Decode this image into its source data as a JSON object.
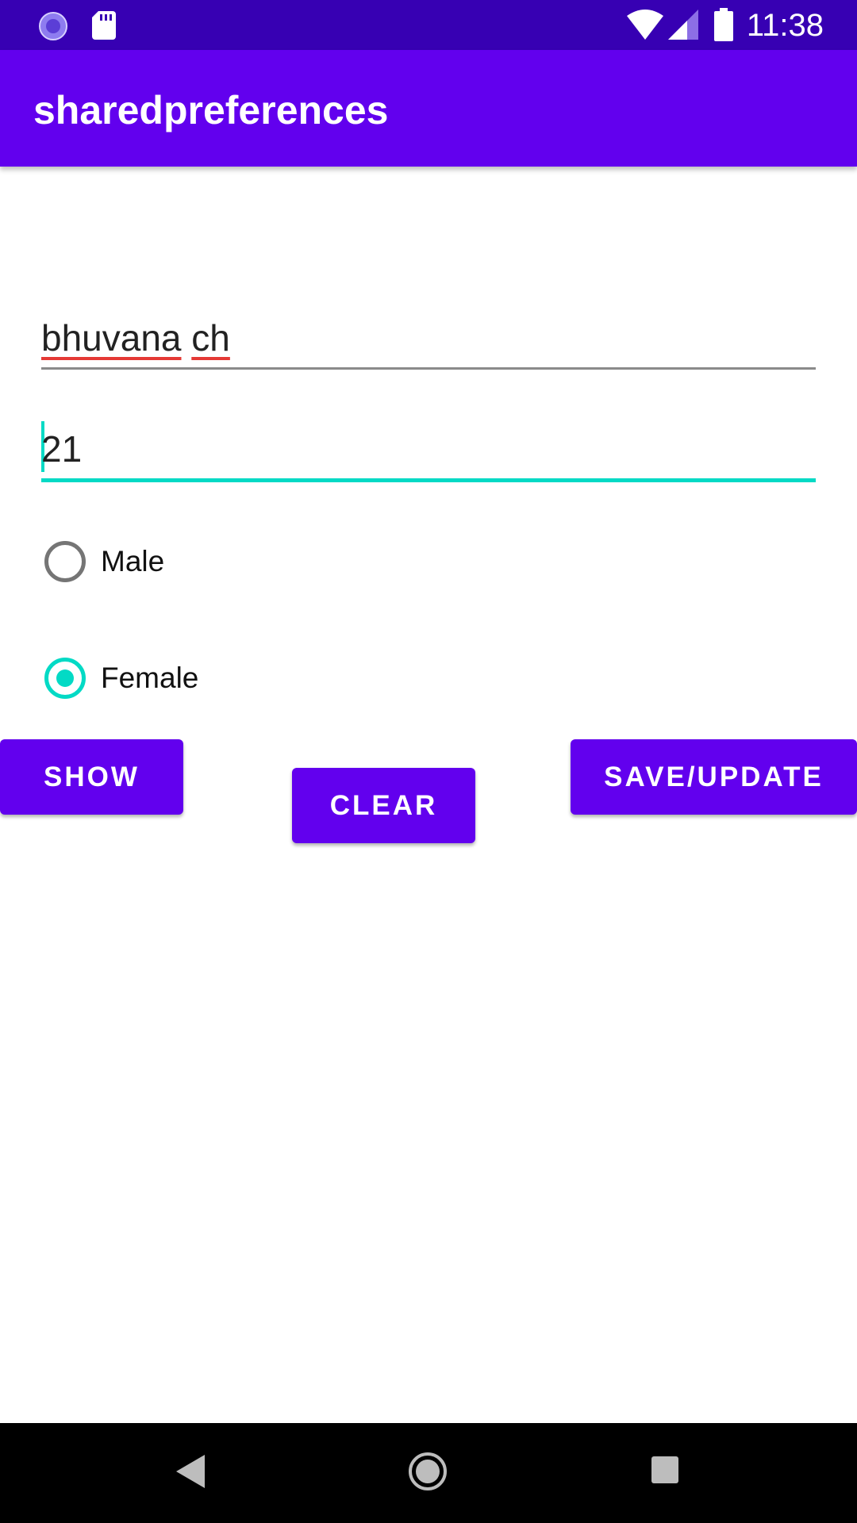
{
  "status_bar": {
    "time": "11:38",
    "icons": [
      "loading-icon",
      "sd-card-icon",
      "wifi-icon",
      "signal-icon",
      "battery-icon"
    ]
  },
  "app_bar": {
    "title": "sharedpreferences"
  },
  "form": {
    "name_value": "bhuvana ch",
    "age_value": "21",
    "gender_options": [
      {
        "label": "Male",
        "checked": false
      },
      {
        "label": "Female",
        "checked": true
      }
    ]
  },
  "buttons": {
    "show": "SHOW",
    "clear": "CLEAR",
    "save_update": "SAVE/UPDATE"
  },
  "nav_bar": {
    "icons": [
      "back-icon",
      "home-icon",
      "recents-icon"
    ]
  },
  "colors": {
    "primary": "#6200ee",
    "primary_dark": "#3700b3",
    "accent": "#03dac5"
  }
}
